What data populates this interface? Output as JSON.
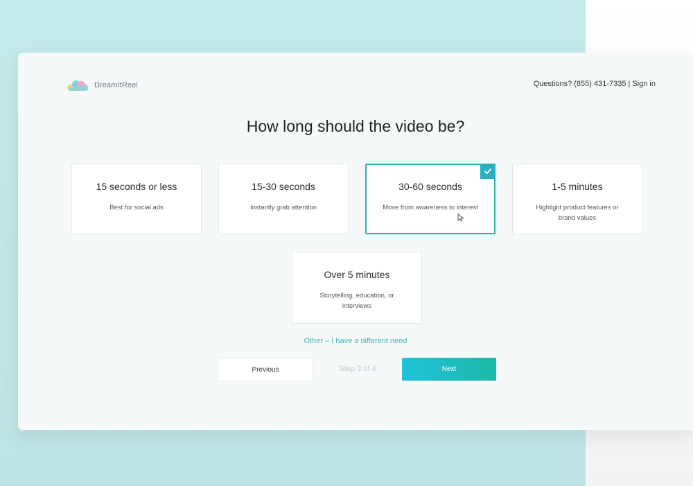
{
  "brand": {
    "name": "DreamItReel"
  },
  "header": {
    "contact": "Questions? (855) 431-7335",
    "separator": "|",
    "signin": "Sign in"
  },
  "question": "How long should the video be?",
  "options": [
    {
      "title": "15 seconds or less",
      "description": "Best for social ads",
      "selected": false
    },
    {
      "title": "15-30 seconds",
      "description": "Instantly grab attention",
      "selected": false
    },
    {
      "title": "30-60 seconds",
      "description": "Move from awareness to interest",
      "selected": true
    },
    {
      "title": "1-5 minutes",
      "description": "Highlight product features or brand values",
      "selected": false
    },
    {
      "title": "Over 5 minutes",
      "description": "Storytelling, education, or interviews",
      "selected": false
    }
  ],
  "other_link": "Other – I have a different need",
  "navigation": {
    "previous_label": "Previous",
    "step_text": "Step 3 of 4",
    "next_label": "Next"
  },
  "colors": {
    "accent": "#2bb3b0",
    "next_gradient_start": "#1ec2d9",
    "next_gradient_end": "#1db9a8",
    "background": "#c3eaea"
  },
  "icons": {
    "selected_badge": "checkmark-icon",
    "logo": "cloud-logo-icon",
    "pointer": "cursor-icon"
  }
}
